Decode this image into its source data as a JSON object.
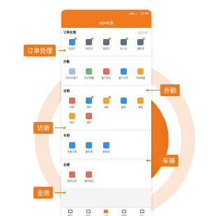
{
  "statusbar": {
    "signal": "ᵢₗ4G ᯤ",
    "time": "11:00"
  },
  "titlebar": {
    "title": "SFA业务"
  },
  "sections": {
    "orders": {
      "title": "订单处理",
      "more": "全部订单 ›",
      "items": [
        {
          "label": "待支付",
          "color": "#3a8ee6"
        },
        {
          "label": "待发货",
          "color": "#5b6f8a"
        },
        {
          "label": "待收货",
          "color": "#5b6f8a"
        },
        {
          "label": "待入仓",
          "color": "#5b6f8a"
        },
        {
          "label": "退换货",
          "color": "#5b6f8a"
        }
      ]
    },
    "field": {
      "title": "外勤",
      "items": [
        {
          "label": "拜访店铺户",
          "color": "#9cc1e8"
        },
        {
          "label": "拜访提醒",
          "color": "#6fb27a"
        },
        {
          "label": "客户登记",
          "color": "#e46a5a"
        },
        {
          "label": "客户分布",
          "color": "#3a8ee6"
        },
        {
          "label": "外勤地图",
          "color": "#f2a23c"
        }
      ]
    },
    "visit": {
      "title": "访销",
      "items": [
        {
          "label": "开单",
          "color": "#e46a5a"
        },
        {
          "label": "退货",
          "color": "#3a8ee6"
        },
        {
          "label": "收款",
          "color": "#f2a23c"
        },
        {
          "label": "盘库",
          "color": "#3a8ee6"
        },
        {
          "label": "调拨",
          "color": "#f2a23c"
        },
        {
          "label": "库存",
          "color": "#f2a23c"
        },
        {
          "label": "借货",
          "color": "#e46a5a"
        }
      ]
    },
    "vehicle": {
      "title": "车销",
      "items": [
        {
          "label": "车销订单",
          "color": "#3a8ee6"
        },
        {
          "label": "整车单",
          "color": "#3a8ee6"
        },
        {
          "label": "整车单",
          "color": "#3a8ee6"
        }
      ]
    },
    "performance": {
      "title": "业绩",
      "items": [
        {
          "label": "我的业绩",
          "color": "#e46a5a"
        },
        {
          "label": "我的拜访",
          "color": "#e46a5a"
        }
      ]
    }
  },
  "tabs": [
    {
      "label": "首页",
      "active": false
    },
    {
      "label": "客户",
      "active": false
    },
    {
      "label": "业务",
      "active": true
    },
    {
      "label": "报表",
      "active": false
    },
    {
      "label": "办公",
      "active": false
    }
  ],
  "callouts": {
    "orders": "订单处理",
    "field": "外勤",
    "visit": "访销",
    "vehicle": "车销",
    "performance": "业绩"
  },
  "colors": {
    "accent": "#ef7a1e"
  }
}
